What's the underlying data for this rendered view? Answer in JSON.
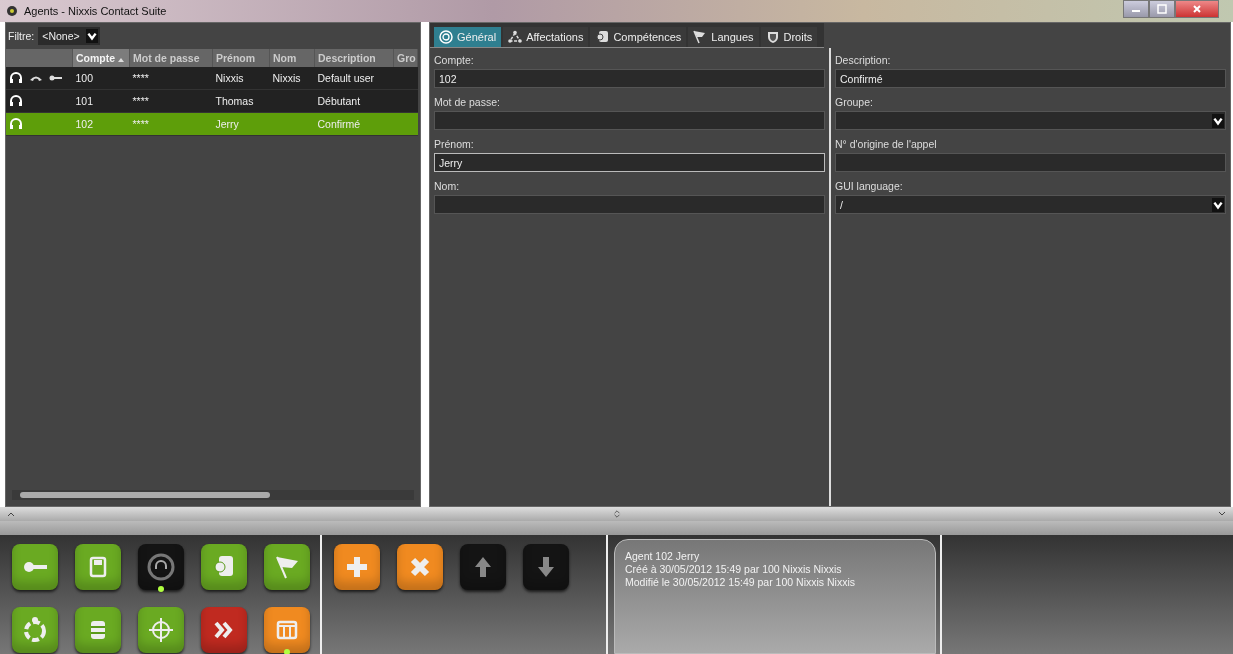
{
  "window": {
    "title": "Agents - Nixxis Contact Suite"
  },
  "filter": {
    "label": "Filtre:",
    "value": "<None>"
  },
  "table": {
    "columns": [
      {
        "sorted": false
      },
      {
        "label": "Compte",
        "sorted": true
      },
      {
        "label": "Mot de passe",
        "sorted": false
      },
      {
        "label": "Prénom",
        "sorted": false
      },
      {
        "label": "Nom",
        "sorted": false
      },
      {
        "label": "Description",
        "sorted": false
      },
      {
        "label": "Gro",
        "sorted": false
      }
    ],
    "rows": [
      {
        "has_phone": true,
        "has_key": true,
        "cells": [
          "",
          "100",
          "****",
          "Nixxis",
          "Nixxis",
          "Default user"
        ],
        "selected": false
      },
      {
        "has_phone": false,
        "has_key": false,
        "cells": [
          "",
          "101",
          "****",
          "Thomas",
          "",
          "Débutant"
        ],
        "selected": false
      },
      {
        "has_phone": false,
        "has_key": false,
        "cells": [
          "",
          "102",
          "****",
          "Jerry",
          "",
          "Confirmé"
        ],
        "selected": true
      }
    ]
  },
  "tabs": [
    {
      "label": "Général",
      "selected": true
    },
    {
      "label": "Affectations",
      "selected": false
    },
    {
      "label": "Compétences",
      "selected": false
    },
    {
      "label": "Langues",
      "selected": false
    },
    {
      "label": "Droits",
      "selected": false
    }
  ],
  "form": {
    "left": [
      {
        "label": "Compte:",
        "kind": "text",
        "value": "102",
        "focused": false
      },
      {
        "label": "Mot de passe:",
        "kind": "text",
        "focused": false
      },
      {
        "label": "Prénom:",
        "kind": "text",
        "value": "Jerry",
        "focused": true
      },
      {
        "label": "Nom:",
        "kind": "text",
        "focused": false
      }
    ],
    "right": [
      {
        "label": "Description:",
        "kind": "text",
        "value": "Confirmé",
        "focused": false
      },
      {
        "label": "Groupe:",
        "kind": "dropdown",
        "focused": false
      },
      {
        "label": "N° d'origine de l'appel",
        "kind": "text",
        "focused": false
      },
      {
        "label": "GUI language:",
        "kind": "dropdown",
        "value": "/",
        "focused": false
      }
    ]
  },
  "toolbar": {
    "groups": [
      [
        {
          "color": "#6aaa22",
          "indicator": false
        },
        {
          "color": "#6aaa22",
          "indicator": false
        },
        {
          "color": "#141414",
          "indicator": true
        },
        {
          "color": "#6aaa22",
          "indicator": false
        },
        {
          "color": "#6aaa22",
          "indicator": false
        },
        {
          "color": "#6aaa22",
          "indicator": false
        },
        {
          "color": "#6aaa22",
          "indicator": false
        },
        {
          "color": "#6aaa22",
          "indicator": false
        },
        {
          "color": "#c02a20",
          "indicator": false
        },
        {
          "color": "#f08a20",
          "indicator": true
        }
      ],
      [
        {
          "color": "#f08a20",
          "indicator": false
        },
        {
          "color": "#f08a20",
          "indicator": false
        },
        {
          "color": "#141414",
          "indicator": false
        },
        {
          "color": "#141414",
          "indicator": false
        }
      ]
    ]
  },
  "info": {
    "lines": [
      "Agent 102 Jerry",
      "Créé à 30/05/2012 15:49 par 100 Nixxis Nixxis",
      "Modifié le 30/05/2012 15:49 par 100 Nixxis Nixxis"
    ]
  }
}
